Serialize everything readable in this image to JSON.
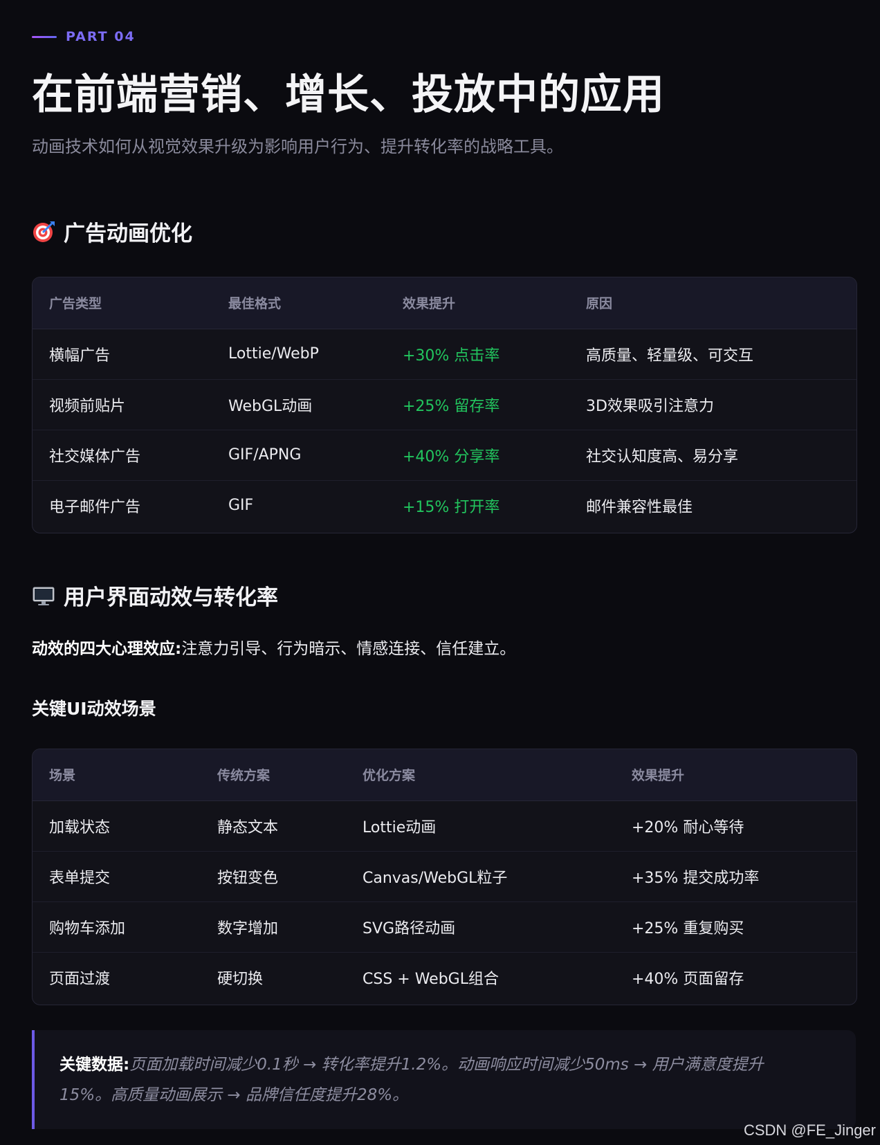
{
  "header": {
    "part_label": "PART 04",
    "title": "在前端营销、增长、投放中的应用",
    "subtitle": "动画技术如何从视觉效果升级为影响用户行为、提升转化率的战略工具。"
  },
  "section1": {
    "icon": "target-icon",
    "title": "广告动画优化",
    "table": {
      "headers": [
        "广告类型",
        "最佳格式",
        "效果提升",
        "原因"
      ],
      "rows": [
        [
          "横幅广告",
          "Lottie/WebP",
          "+30% 点击率",
          "高质量、轻量级、可交互"
        ],
        [
          "视频前贴片",
          "WebGL动画",
          "+25% 留存率",
          "3D效果吸引注意力"
        ],
        [
          "社交媒体广告",
          "GIF/APNG",
          "+40% 分享率",
          "社交认知度高、易分享"
        ],
        [
          "电子邮件广告",
          "GIF",
          "+15% 打开率",
          "邮件兼容性最佳"
        ]
      ]
    }
  },
  "section2": {
    "icon": "monitor-icon",
    "title": "用户界面动效与转化率",
    "intro_label": "动效的四大心理效应:",
    "intro_text": "注意力引导、行为暗示、情感连接、信任建立。",
    "subheading": "关键UI动效场景",
    "table": {
      "headers": [
        "场景",
        "传统方案",
        "优化方案",
        "效果提升"
      ],
      "rows": [
        [
          "加载状态",
          "静态文本",
          "Lottie动画",
          "+20% 耐心等待"
        ],
        [
          "表单提交",
          "按钮变色",
          "Canvas/WebGL粒子",
          "+35% 提交成功率"
        ],
        [
          "购物车添加",
          "数字增加",
          "SVG路径动画",
          "+25% 重复购买"
        ],
        [
          "页面过渡",
          "硬切换",
          "CSS + WebGL组合",
          "+40% 页面留存"
        ]
      ]
    }
  },
  "callout": {
    "label": "关键数据:",
    "text": "页面加载时间减少0.1秒 → 转化率提升1.2%。动画响应时间减少50ms → 用户满意度提升15%。高质量动画展示 → 品牌信任度提升28%。"
  },
  "watermark": "CSDN @FE_Jinger",
  "colors": {
    "background": "#0b0b10",
    "accent": "#7c6cf5",
    "positive": "#22c55e"
  }
}
